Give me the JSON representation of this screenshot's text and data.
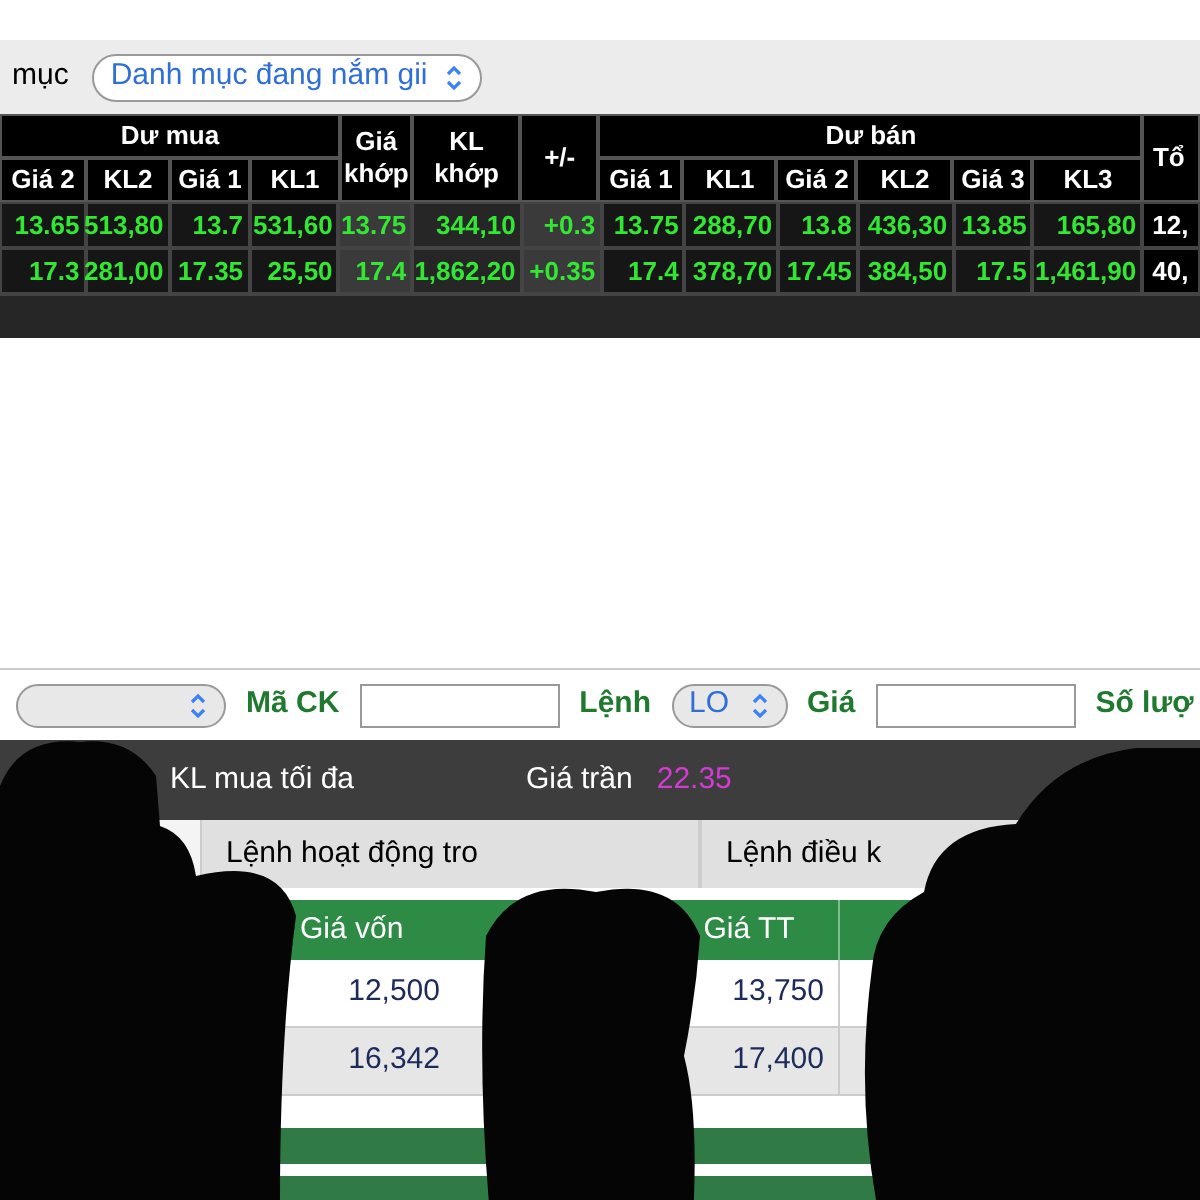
{
  "portfolio_filter": {
    "label": "mục",
    "value": "Danh mục đang nắm gii"
  },
  "price_board": {
    "buy_header": "Dư mua",
    "buy_columns": [
      "Giá 2",
      "KL2",
      "Giá 1",
      "KL1"
    ],
    "match_columns": [
      "Giá khớp",
      "KL khớp",
      "+/-"
    ],
    "sell_header": "Dư bán",
    "sell_columns": [
      "Giá 1",
      "KL1",
      "Giá 2",
      "KL2",
      "Giá 3",
      "KL3"
    ],
    "total_column": "Tổ",
    "rows": [
      {
        "cells": [
          "13.65",
          "513,80",
          "13.7",
          "531,60",
          "13.75",
          "344,10",
          "+0.3",
          "13.75",
          "288,70",
          "13.8",
          "436,30",
          "13.85",
          "165,80",
          "12,"
        ]
      },
      {
        "cells": [
          "17.3",
          "281,00",
          "17.35",
          "25,50",
          "17.4",
          "1,862,20",
          "+0.35",
          "17.4",
          "378,70",
          "17.45",
          "384,50",
          "17.5",
          "1,461,90",
          "40,"
        ]
      }
    ]
  },
  "order_form": [
    {
      "kind": "select"
    },
    {
      "kind": "input",
      "label": "Mã CK"
    },
    {
      "kind": "select",
      "label": "Lệnh",
      "value": "LO"
    },
    {
      "kind": "input",
      "label": "Giá"
    },
    {
      "kind": "label",
      "label": "Số lượ"
    }
  ],
  "info_bar": [
    {
      "label": "KL mua tối đa"
    },
    {
      "label": "Giá trần",
      "value": "22.35"
    }
  ],
  "tabs": [
    "Lệnh hoạt động tro",
    "Lệnh điều k"
  ],
  "holdings": {
    "columns": [
      "Giá vốn",
      "Giá TT"
    ],
    "rows": [
      [
        "12,500",
        "13,750"
      ],
      [
        "16,342",
        "17,400"
      ]
    ]
  }
}
